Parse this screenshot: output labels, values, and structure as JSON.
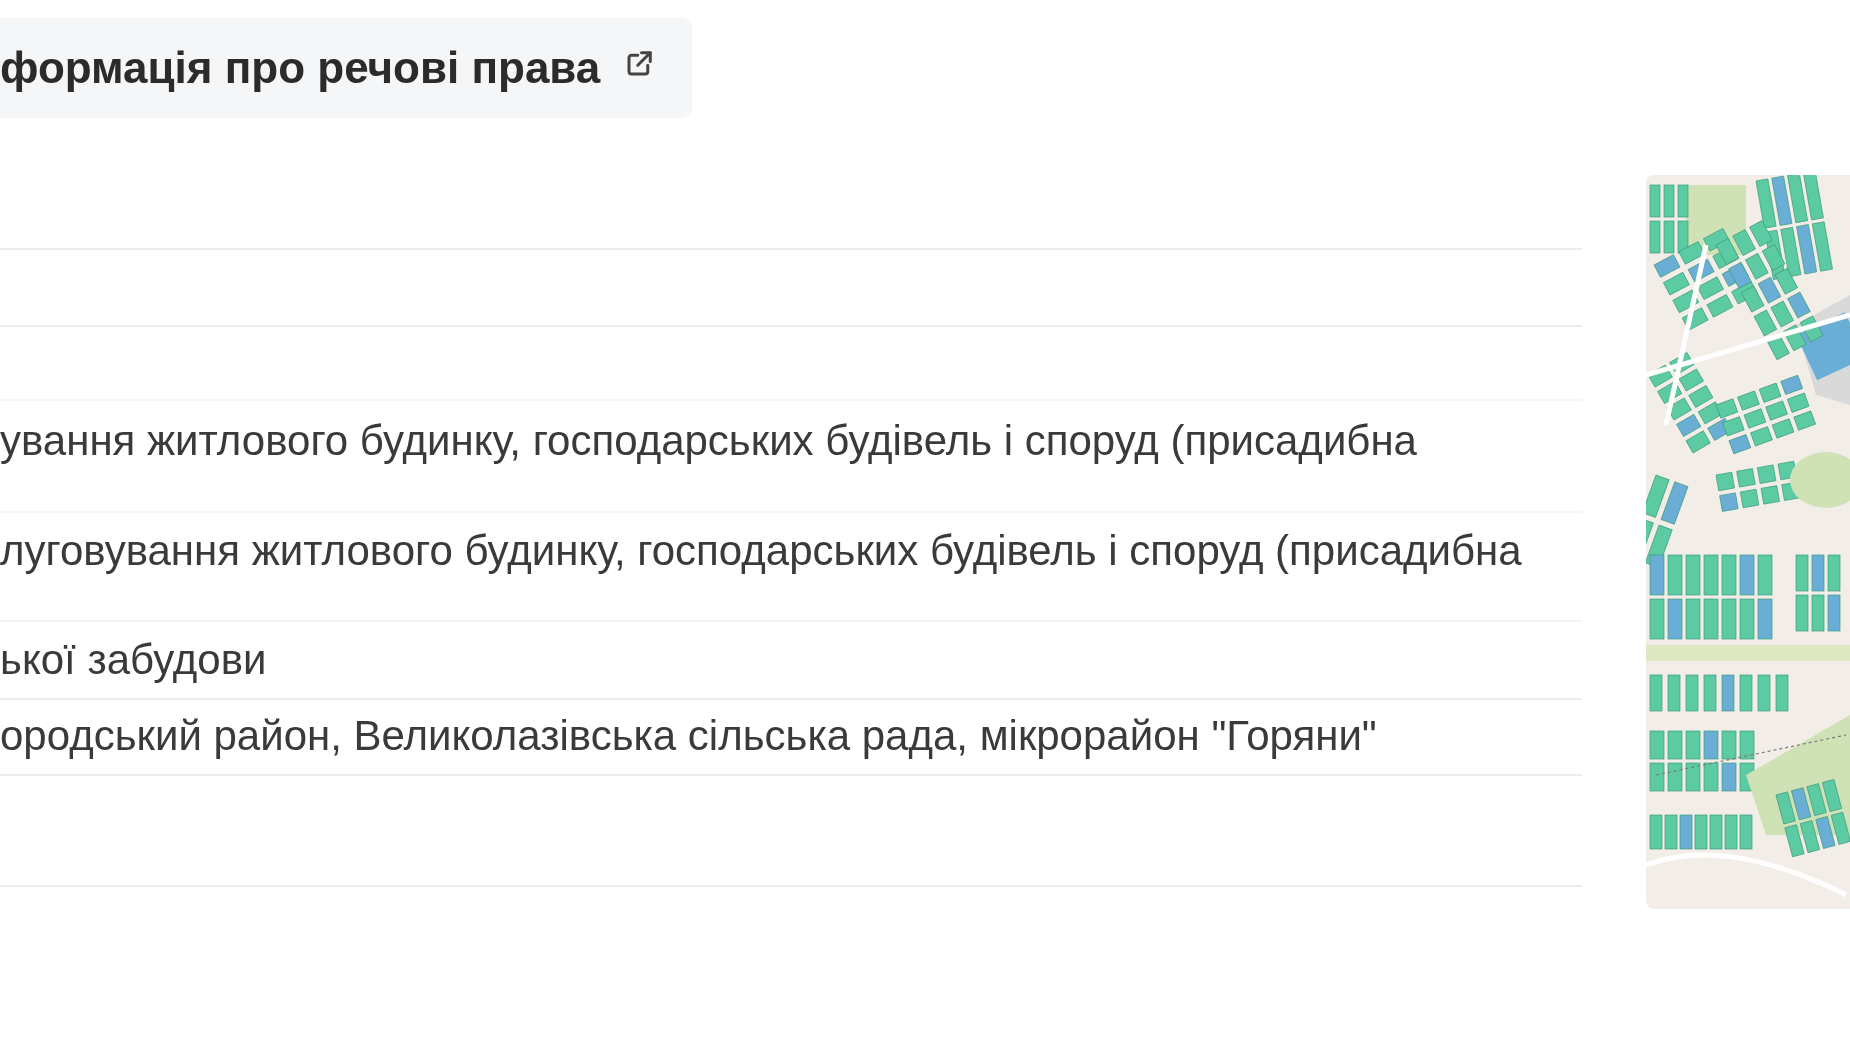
{
  "rights_link": {
    "label": "формація про речові права"
  },
  "fields": [
    {
      "value": "ування житлового будинку, господарських будівель і споруд (присадибна"
    },
    {
      "value": "луговування житлового будинку, господарських будівель і споруд (присадибна"
    },
    {
      "value": "ької забудови"
    },
    {
      "value": "ородський район, Великолазівська сільська рада, мікрорайон \"Горяни\""
    }
  ]
}
